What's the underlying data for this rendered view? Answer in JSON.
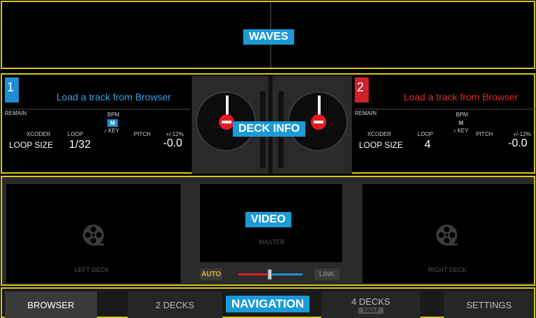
{
  "sections": {
    "waves": "WAVES",
    "deck_info": "DECK INFO",
    "video": "VIDEO",
    "navigation": "NAVIGATION"
  },
  "decks": [
    {
      "number": "1",
      "title": "Load a track from Browser",
      "remain_label": "REMAIN",
      "bpm_label": "BPM",
      "bpm_badge": "M",
      "key_label": "♪ KEY",
      "xcoder_label": "XCODER",
      "loop_label": "LOOP",
      "pitch_label": "PITCH",
      "pitch_range": "+/-12%",
      "loop_size_label": "LOOP SIZE",
      "loop_value": "1/32",
      "pitch_value": "-0.0",
      "color": "#1c8fd3"
    },
    {
      "number": "2",
      "title": "Load a track from Browser",
      "remain_label": "REMAIN",
      "bpm_label": "BPM",
      "bpm_badge": "M",
      "key_label": "♪ KEY",
      "xcoder_label": "XCODER",
      "loop_label": "LOOP",
      "pitch_label": "PITCH",
      "pitch_range": "+/-12%",
      "loop_size_label": "LOOP SIZE",
      "loop_value": "4",
      "pitch_value": "-0.0",
      "color": "#d0212a"
    }
  ],
  "video": {
    "left_deck": "LEFT DECK",
    "right_deck": "RIGHT DECK",
    "master": "MASTER",
    "auto": "AUTO",
    "link": "LINK",
    "reel_icon": "film-reel-icon"
  },
  "nav": {
    "browser": "BROWSER",
    "two_decks": "2 DECKS",
    "four_decks": "4 DECKS",
    "swap": "SWAP",
    "settings": "SETTINGS"
  },
  "colors": {
    "accent_blue": "#1c9ad6",
    "deck1": "#1c8fd3",
    "deck2": "#d0212a",
    "frame": "#d9c71c",
    "auto": "#e8b62a"
  }
}
